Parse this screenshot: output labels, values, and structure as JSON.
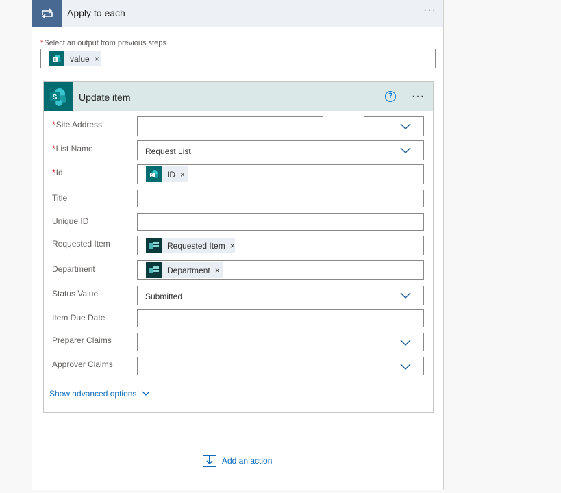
{
  "loop": {
    "title": "Apply to each",
    "more": "···",
    "select_label": "Select an output from previous steps",
    "required_mark": "*",
    "token": {
      "label": "value",
      "remove": "×"
    }
  },
  "action": {
    "title": "Update item",
    "help": "?",
    "more": "···",
    "fields": [
      {
        "label": "Site Address",
        "required": "*",
        "value": ""
      },
      {
        "label": "List Name",
        "required": "*",
        "value": "Request List"
      },
      {
        "label": "Id",
        "required": "*",
        "token": "ID",
        "remove": "×"
      },
      {
        "label": "Title",
        "value": ""
      },
      {
        "label": "Unique ID",
        "value": ""
      },
      {
        "label": "Requested Item",
        "token": "Requested Item",
        "remove": "×"
      },
      {
        "label": "Department",
        "token": "Department",
        "remove": "×"
      },
      {
        "label": "Status Value",
        "value": "Submitted"
      },
      {
        "label": "Item Due Date",
        "value": ""
      },
      {
        "label": "Preparer Claims",
        "value": ""
      },
      {
        "label": "Approver Claims",
        "value": ""
      }
    ],
    "advanced": "Show advanced options"
  },
  "add_action": "Add an action",
  "colors": {
    "loop_accent": "#486991",
    "sharepoint": "#036c70",
    "forms": "#0b3a3c",
    "link": "#0f6cbd",
    "chevron": "#1f5f9e"
  }
}
